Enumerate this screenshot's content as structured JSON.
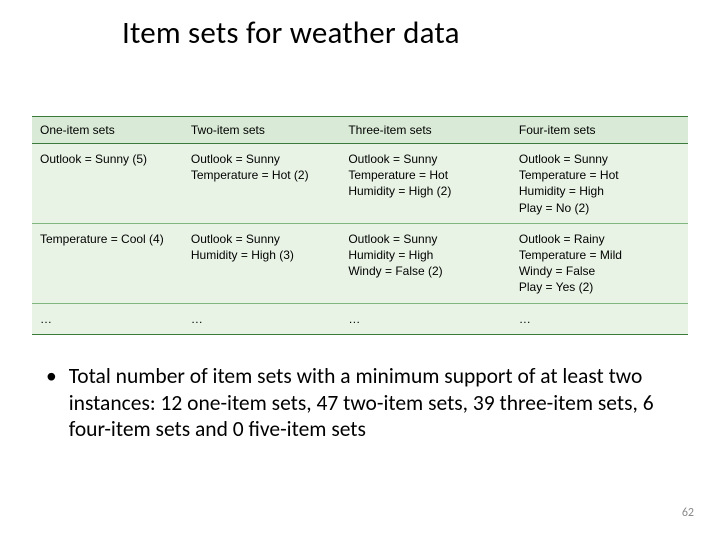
{
  "title": "Item sets for weather data",
  "table": {
    "headers": [
      "One-item sets",
      "Two-item sets",
      "Three-item sets",
      "Four-item sets"
    ],
    "rows": [
      {
        "c1": [
          "Outlook = Sunny (5)"
        ],
        "c2": [
          "Outlook = Sunny",
          "Temperature = Hot (2)"
        ],
        "c3": [
          "Outlook = Sunny",
          "Temperature = Hot",
          "Humidity = High (2)"
        ],
        "c4": [
          "Outlook = Sunny",
          "Temperature = Hot",
          "Humidity = High",
          "Play = No (2)"
        ]
      },
      {
        "c1": [
          "Temperature = Cool (4)"
        ],
        "c2": [
          "Outlook = Sunny",
          "Humidity = High (3)"
        ],
        "c3": [
          "Outlook = Sunny",
          "Humidity = High",
          "Windy = False (2)"
        ],
        "c4": [
          "Outlook = Rainy",
          "Temperature = Mild",
          "Windy = False",
          "Play = Yes (2)"
        ]
      },
      {
        "c1": [
          "…"
        ],
        "c2": [
          "…"
        ],
        "c3": [
          "…"
        ],
        "c4": [
          "…"
        ]
      }
    ]
  },
  "bullet": "Total number of item sets with a minimum support of at least two instances: 12 one-item sets, 47 two-item sets, 39 three-item sets, 6 four-item sets and 0 five-item sets",
  "page_number": "62"
}
